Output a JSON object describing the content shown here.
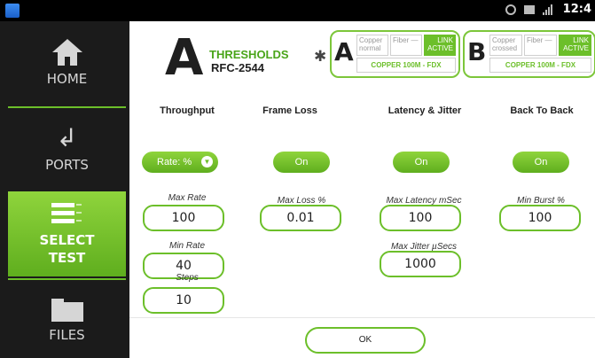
{
  "status_bar": {
    "time": "12:4"
  },
  "sidebar": {
    "items": [
      {
        "label": "HOME",
        "icon": "home-icon"
      },
      {
        "label": "PORTS",
        "icon": "ports-icon"
      },
      {
        "label_line1": "SELECT",
        "label_line2": "TEST",
        "icon": "select-test-icon",
        "selected": true
      },
      {
        "label": "FILES",
        "icon": "folder-icon"
      }
    ]
  },
  "header": {
    "port_letter": "A",
    "title": "THRESHOLDS",
    "subtitle": "RFC-2544"
  },
  "ports": [
    {
      "letter": "A",
      "cells": [
        "Copper normal",
        "Fiber —",
        "LINK ACTIVE"
      ],
      "status": "COPPER 100M - FDX"
    },
    {
      "letter": "B",
      "cells": [
        "Copper crossed",
        "Fiber —",
        "LINK ACTIVE"
      ],
      "status": "COPPER 100M - FDX"
    }
  ],
  "columns": {
    "throughput": {
      "title": "Throughput",
      "select_label": "Rate: %",
      "fields": [
        {
          "label": "Max Rate",
          "value": "100"
        },
        {
          "label": "Min Rate",
          "value": "40"
        },
        {
          "label": "Steps",
          "value": "10"
        }
      ]
    },
    "frame_loss": {
      "title": "Frame Loss",
      "toggle": "On",
      "fields": [
        {
          "label": "Max Loss %",
          "value": "0.01"
        }
      ]
    },
    "latency": {
      "title": "Latency & Jitter",
      "toggle": "On",
      "fields": [
        {
          "label": "Max Latency mSec",
          "value": "100"
        },
        {
          "label": "Max Jitter µSecs",
          "value": "1000"
        }
      ]
    },
    "back_to_back": {
      "title": "Back To Back",
      "toggle": "On",
      "fields": [
        {
          "label": "Min Burst %",
          "value": "100"
        }
      ]
    }
  },
  "ok_button": "OK",
  "colors": {
    "accent": "#6cbf2a",
    "accent_light": "#8fd43c",
    "sidebar_bg": "#1b1b1b"
  }
}
